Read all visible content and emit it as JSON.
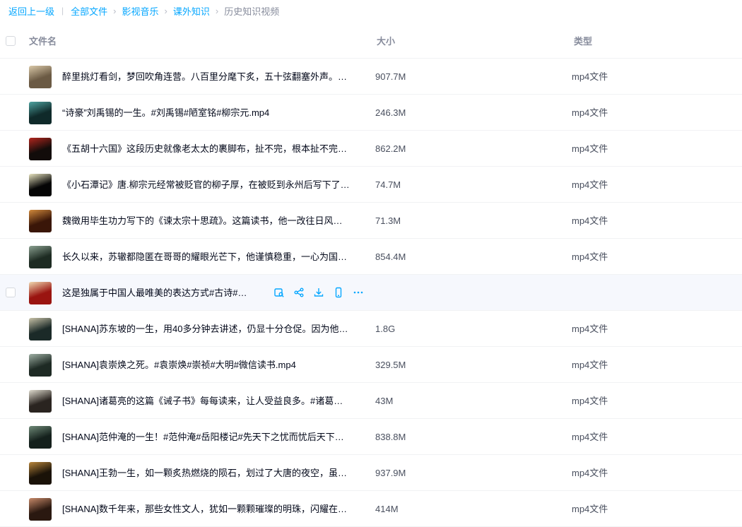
{
  "breadcrumb": {
    "back": "返回上一级",
    "items": [
      "全部文件",
      "影视音乐",
      "课外知识"
    ],
    "current": "历史知识视频"
  },
  "header": {
    "name": "文件名",
    "size": "大小",
    "type": "类型"
  },
  "colors": {
    "accent": "#06a7ff",
    "hover_row": "#f6f8fd"
  },
  "rows": [
    {
      "name": "醉里挑灯看剑，梦回吹角连营。八百里分麾下炙，五十弦翻塞外声。…",
      "size": "907.7M",
      "type": "mp4文件",
      "thumb": [
        "#6b5a44",
        "#d9c8a8"
      ]
    },
    {
      "name": "“诗豪”刘禹锡的一生。#刘禹锡#陋室铭#柳宗元.mp4",
      "size": "246.3M",
      "type": "mp4文件",
      "thumb": [
        "#0f2a2a",
        "#4fa3a0"
      ]
    },
    {
      "name": "《五胡十六国》这段历史就像老太太的裹脚布，扯不完，根本扯不完…",
      "size": "862.2M",
      "type": "mp4文件",
      "thumb": [
        "#120c0a",
        "#b3261e"
      ]
    },
    {
      "name": "《小石潭记》唐.柳宗元经常被贬官的柳子厚，在被贬到永州后写下了…",
      "size": "74.7M",
      "type": "mp4文件",
      "thumb": [
        "#050505",
        "#e8e4c0"
      ]
    },
    {
      "name": "魏徵用毕生功力写下的《谏太宗十思疏》。这篇读书，他一改往日风…",
      "size": "71.3M",
      "type": "mp4文件",
      "thumb": [
        "#3a1608",
        "#d28a3c"
      ]
    },
    {
      "name": "长久以来，苏辙都隐匿在哥哥的耀眼光芒下，他谨慎稳重，一心为国…",
      "size": "854.4M",
      "type": "mp4文件",
      "thumb": [
        "#1d2b22",
        "#8aa090"
      ]
    },
    {
      "name": "这是独属于中国人最唯美的表达方式#古诗#…",
      "size": "",
      "type": "",
      "thumb": [
        "#9a1410",
        "#f0d9b0"
      ],
      "hover": true
    },
    {
      "name": "[SHANA]苏东坡的一生，用40多分钟去讲述，仍显十分仓促。因为他…",
      "size": "1.8G",
      "type": "mp4文件",
      "thumb": [
        "#1b2a28",
        "#c9c3a8"
      ]
    },
    {
      "name": "[SHANA]袁崇焕之死。#袁崇焕#崇祯#大明#微信读书.mp4",
      "size": "329.5M",
      "type": "mp4文件",
      "thumb": [
        "#1e2a24",
        "#9fb0a4"
      ]
    },
    {
      "name": "[SHANA]诸葛亮的这篇《诫子书》每每读来，让人受益良多。#诸葛…",
      "size": "43M",
      "type": "mp4文件",
      "thumb": [
        "#2a2420",
        "#e0dccf"
      ]
    },
    {
      "name": "[SHANA]范仲淹的一生！#范仲淹#岳阳楼记#先天下之忧而忧后天下…",
      "size": "838.8M",
      "type": "mp4文件",
      "thumb": [
        "#14201c",
        "#6f8a78"
      ]
    },
    {
      "name": "[SHANA]王勃一生，如一颗炙热燃烧的陨石，划过了大唐的夜空，虽…",
      "size": "937.9M",
      "type": "mp4文件",
      "thumb": [
        "#1a1208",
        "#b8863c"
      ]
    },
    {
      "name": "[SHANA]数千年来，那些女性文人，犹如一颗颗璀璨的明珠，闪耀在…",
      "size": "414M",
      "type": "mp4文件",
      "thumb": [
        "#2a1810",
        "#c88a6a"
      ]
    }
  ],
  "hover_actions": [
    {
      "name": "preview-icon"
    },
    {
      "name": "share-icon"
    },
    {
      "name": "download-icon"
    },
    {
      "name": "phone-icon"
    },
    {
      "name": "more-icon"
    }
  ]
}
